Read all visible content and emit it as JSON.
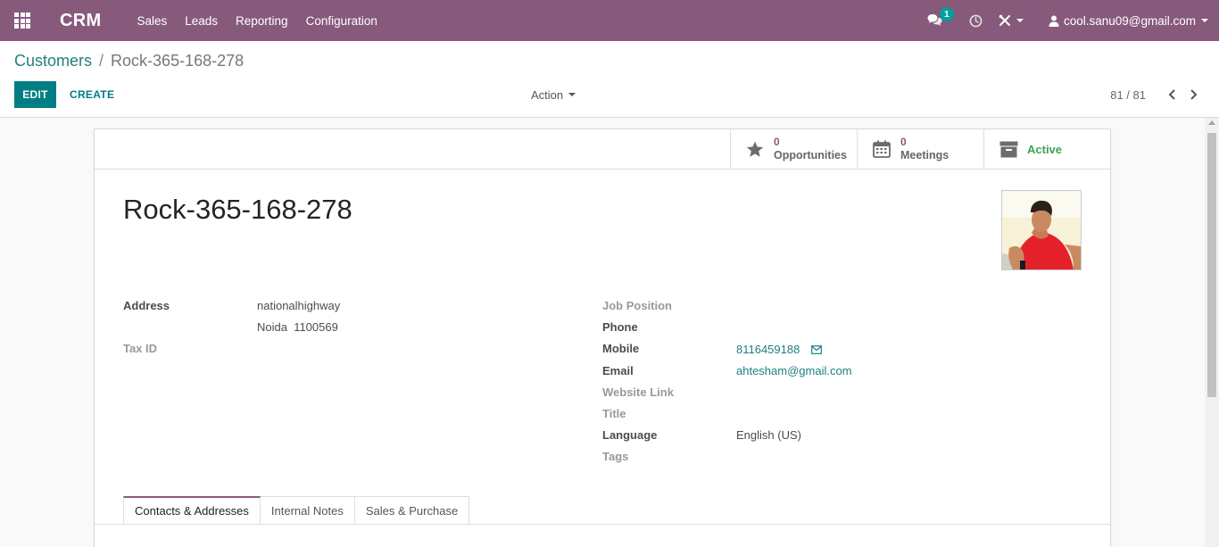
{
  "navbar": {
    "brand": "CRM",
    "menu": [
      "Sales",
      "Leads",
      "Reporting",
      "Configuration"
    ],
    "chat_badge": "1",
    "user": "cool.sanu09@gmail.com"
  },
  "breadcrumb": {
    "parent": "Customers",
    "separator": "/",
    "current": "Rock-365-168-278"
  },
  "toolbar": {
    "edit_label": "EDIT",
    "create_label": "CREATE",
    "action_label": "Action",
    "pager_value": "81 / 81"
  },
  "smart_buttons": {
    "opportunities": {
      "count": "0",
      "label": "Opportunities"
    },
    "meetings": {
      "count": "0",
      "label": "Meetings"
    },
    "active": {
      "label": "Active"
    }
  },
  "record": {
    "name": "Rock-365-168-278",
    "address_label": "Address",
    "address_line1": "nationalhighway",
    "address_line2": "Noida  1100569",
    "tax_id_label": "Tax ID",
    "job_position_label": "Job Position",
    "phone_label": "Phone",
    "mobile_label": "Mobile",
    "mobile_value": "8116459188",
    "email_label": "Email",
    "email_value": "ahtesham@gmail.com",
    "website_label": "Website Link",
    "title_label": "Title",
    "language_label": "Language",
    "language_value": "English (US)",
    "tags_label": "Tags"
  },
  "tabs": [
    "Contacts & Addresses",
    "Internal Notes",
    "Sales & Purchase"
  ],
  "colors": {
    "navbar": "#875a7b",
    "primary": "#017e84",
    "active_green": "#40a14f"
  }
}
